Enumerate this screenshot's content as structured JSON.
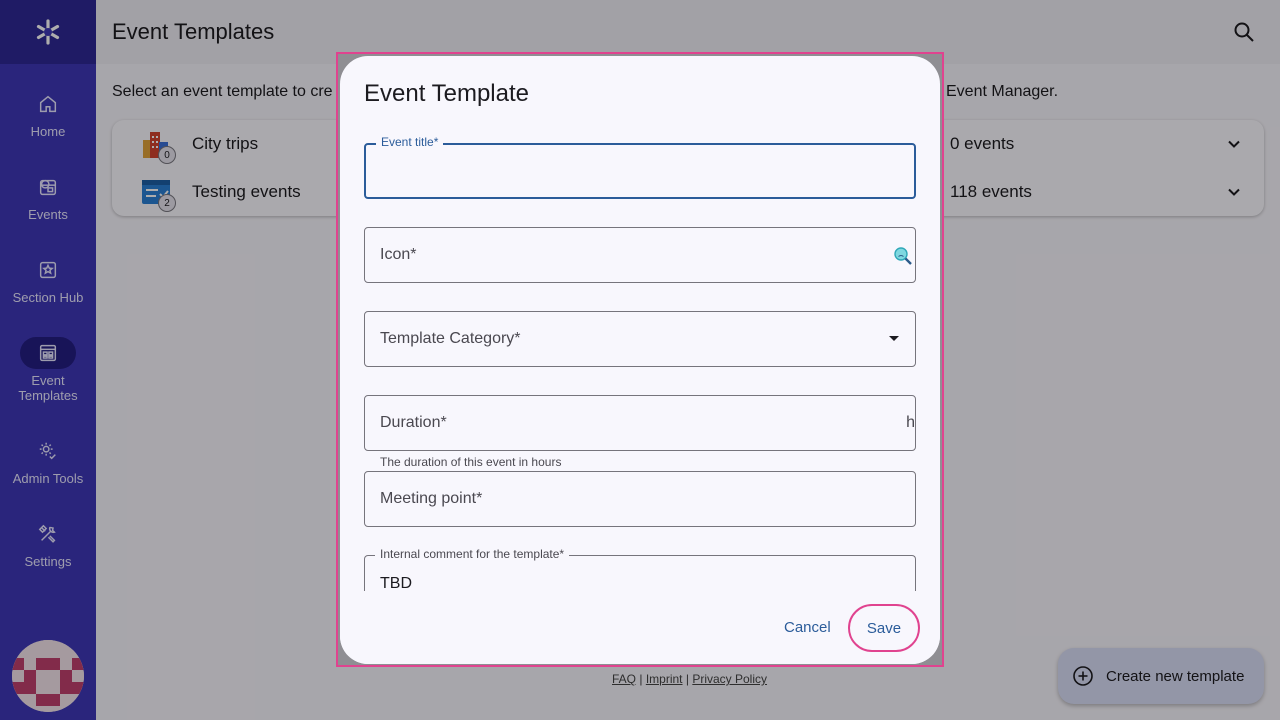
{
  "app": {
    "title": "Event Templates"
  },
  "sidebar": {
    "items": [
      {
        "label": "Home",
        "icon": "home-icon"
      },
      {
        "label": "Events",
        "icon": "events-icon"
      },
      {
        "label": "Section Hub",
        "icon": "section-hub-icon"
      },
      {
        "label_line1": "Event",
        "label_line2": "Templates",
        "icon": "event-templates-icon",
        "active": true
      },
      {
        "label": "Admin Tools",
        "icon": "admin-tools-icon"
      },
      {
        "label": "Settings",
        "icon": "settings-icon"
      }
    ]
  },
  "main": {
    "intro_left": "Select an event template to cre",
    "intro_right": "Event Manager.",
    "templates": [
      {
        "name": "City trips",
        "badge": "0",
        "count": "0 events",
        "icon": "city-buildings-icon"
      },
      {
        "name": "Testing events",
        "badge": "2",
        "count": "118 events",
        "icon": "checklist-icon"
      }
    ]
  },
  "footer": {
    "faq": "FAQ",
    "sep1": "|",
    "imprint": "Imprint",
    "sep2": "|",
    "privacy": "Privacy Policy"
  },
  "fab": {
    "label": "Create new template"
  },
  "dialog": {
    "title": "Event Template",
    "fields": {
      "event_title": {
        "label": "Event title*",
        "value": ""
      },
      "icon": {
        "placeholder": "Icon*"
      },
      "category": {
        "placeholder": "Template Category*"
      },
      "duration": {
        "placeholder": "Duration*",
        "suffix": "h",
        "helper": "The duration of this event in hours"
      },
      "meeting_point": {
        "placeholder": "Meeting point*"
      },
      "internal_comment": {
        "label": "Internal comment for the template*",
        "value": "TBD"
      }
    },
    "cancel_label": "Cancel",
    "save_label": "Save"
  },
  "colors": {
    "sidebar": "#3f37b7",
    "accent": "#2b5c9a",
    "highlight": "#e0438f"
  }
}
